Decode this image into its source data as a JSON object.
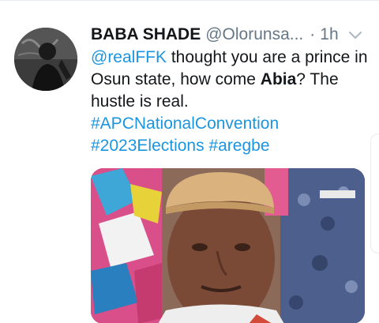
{
  "tweet": {
    "display_name": "BABA SHADE",
    "handle": "@Olorunsa...",
    "separator": "·",
    "time": "1h",
    "menu_icon": "chevron-down-icon",
    "text": {
      "mention": "@realFFK",
      "part1": " thought you are a prince in Osun state, how come ",
      "bold": "Abia",
      "part2": "? The hustle is real."
    },
    "hashtags": {
      "tag1": "#APCNationalConvention",
      "tag2": "#2023Elections",
      "tag3": "#aregbe"
    }
  },
  "colors": {
    "link": "#1b95e0",
    "text": "#14171a",
    "secondary": "#657786",
    "divider": "#e6ecf0"
  }
}
